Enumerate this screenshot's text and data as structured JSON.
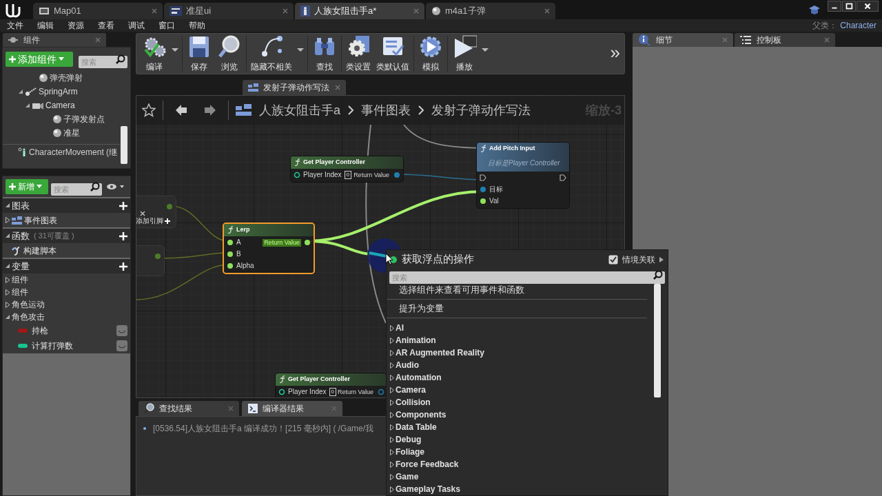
{
  "title_bar": {
    "tabs": [
      {
        "label": "Map01",
        "selected": false
      },
      {
        "label": "准星ui",
        "selected": false
      },
      {
        "label": "人族女阻击手a*",
        "selected": true
      },
      {
        "label": "m4a1子弹",
        "selected": false
      }
    ]
  },
  "menu_bar": {
    "items": [
      "文件",
      "编辑",
      "资源",
      "查看",
      "调试",
      "窗口",
      "帮助"
    ],
    "parent_class_label": "父类：",
    "parent_class": "Character"
  },
  "components_panel": {
    "tab": "组件",
    "add_button": "添加组件",
    "search_placeholder": "搜索",
    "tree": [
      {
        "label": "弹壳弹射",
        "kind": "scene"
      },
      {
        "label": "SpringArm",
        "kind": "springarm",
        "expanded": true,
        "children": [
          {
            "label": "Camera",
            "kind": "camera",
            "expanded": true,
            "children": [
              {
                "label": "子弹发射点",
                "kind": "scene"
              },
              {
                "label": "准星",
                "kind": "scene"
              }
            ]
          }
        ]
      }
    ],
    "footer_item": "CharacterMovement (继"
  },
  "my_blueprint": {
    "add_button": "新增",
    "search_placeholder": "搜索",
    "sections": [
      {
        "title": "图表",
        "items": [
          {
            "label": "事件图表",
            "kind": "graph"
          }
        ]
      },
      {
        "title": "函数",
        "note": "( 31可覆盖 )",
        "items": [
          {
            "label": "构建脚本",
            "kind": "function"
          }
        ]
      },
      {
        "title": "变量",
        "items": [
          {
            "label": "组件",
            "kind": "category",
            "expanded": false
          },
          {
            "label": "组件",
            "kind": "category",
            "expanded": false
          },
          {
            "label": "角色运动",
            "kind": "category",
            "expanded": false
          },
          {
            "label": "角色攻击",
            "kind": "category",
            "expanded": true,
            "children": [
              {
                "label": "持枪",
                "kind": "variable",
                "color": "#a01818"
              },
              {
                "label": "计算打弹数",
                "kind": "variable",
                "color": "#18c48e"
              }
            ]
          }
        ]
      }
    ]
  },
  "toolbar": {
    "buttons": [
      {
        "label": "编译",
        "dropdown": true
      },
      {
        "label": "保存",
        "dropdown": false
      },
      {
        "label": "浏览",
        "dropdown": false
      },
      {
        "label": "隐藏不相关",
        "dropdown": true
      },
      {
        "label": "查找",
        "dropdown": false
      },
      {
        "label": "类设置",
        "dropdown": false
      },
      {
        "label": "类默认值",
        "dropdown": false
      },
      {
        "label": "模拟",
        "dropdown": false
      },
      {
        "label": "播放",
        "dropdown": true
      }
    ],
    "overflow": "»"
  },
  "graph_tab": {
    "label": "发射子弹动作写法"
  },
  "breadcrumb": [
    "人族女阻击手a",
    "事件图表",
    "发射子弹动作写法"
  ],
  "zoom_label": "缩放-3",
  "graph": {
    "nodes": [
      {
        "kind": "clipped",
        "pin_label": "添加引脚"
      },
      {
        "kind": "clipped"
      },
      {
        "kind": "function",
        "pure": true,
        "selected": false,
        "title": "Get Player Controller",
        "inputs": [
          {
            "label": "Player Index",
            "kind": "int",
            "connected": false,
            "value": "0"
          }
        ],
        "outputs": [
          {
            "label": "Return Value",
            "kind": "object",
            "connected": true
          }
        ]
      },
      {
        "kind": "function",
        "pure": false,
        "selected": false,
        "title": "Add Pitch Input",
        "subtitle": "目标是Player Controller",
        "inputs": [
          {
            "kind": "exec",
            "connected": false
          },
          {
            "label": "目标",
            "kind": "object",
            "connected": true
          },
          {
            "label": "Val",
            "kind": "float",
            "connected": true
          }
        ],
        "outputs": [
          {
            "kind": "exec",
            "connected": false
          }
        ]
      },
      {
        "kind": "function",
        "pure": true,
        "selected": true,
        "title": "Lerp",
        "inputs": [
          {
            "label": "A",
            "kind": "float",
            "connected": true
          },
          {
            "label": "B",
            "kind": "float",
            "connected": true
          },
          {
            "label": "Alpha",
            "kind": "float",
            "connected": true
          }
        ],
        "outputs": [
          {
            "label": "Return Value",
            "kind": "float",
            "connected": true,
            "active": true
          }
        ]
      },
      {
        "kind": "function",
        "pure": true,
        "selected": false,
        "title": "Get Player Controller",
        "inputs": [
          {
            "label": "Player Index",
            "kind": "int",
            "connected": false,
            "value": "0"
          }
        ],
        "outputs": [
          {
            "label": "Return Value",
            "kind": "object",
            "connected": false
          }
        ]
      }
    ]
  },
  "bottom_panel": {
    "tabs": [
      {
        "label": "查找结果",
        "selected": false
      },
      {
        "label": "编译器结果",
        "selected": true
      }
    ],
    "log": [
      "[0536.54]人族女阻击手a 编译成功！[215 毫秒内] ( /Game/我"
    ]
  },
  "details_panel": {
    "tabs": [
      {
        "label": "细节",
        "selected": true
      },
      {
        "label": "控制板",
        "selected": false
      }
    ]
  },
  "context_menu": {
    "title": "获取浮点的操作",
    "context_label": "情境关联",
    "context_checked": true,
    "search_placeholder": "搜索",
    "actions": [
      "选择组件来查看可用事件和函数",
      "提升为变量"
    ],
    "categories": [
      "AI",
      "Animation",
      "AR Augmented Reality",
      "Audio",
      "Automation",
      "Camera",
      "Collision",
      "Components",
      "Data Table",
      "Debug",
      "Foliage",
      "Force Feedback",
      "Game",
      "Gameplay Tasks"
    ]
  }
}
